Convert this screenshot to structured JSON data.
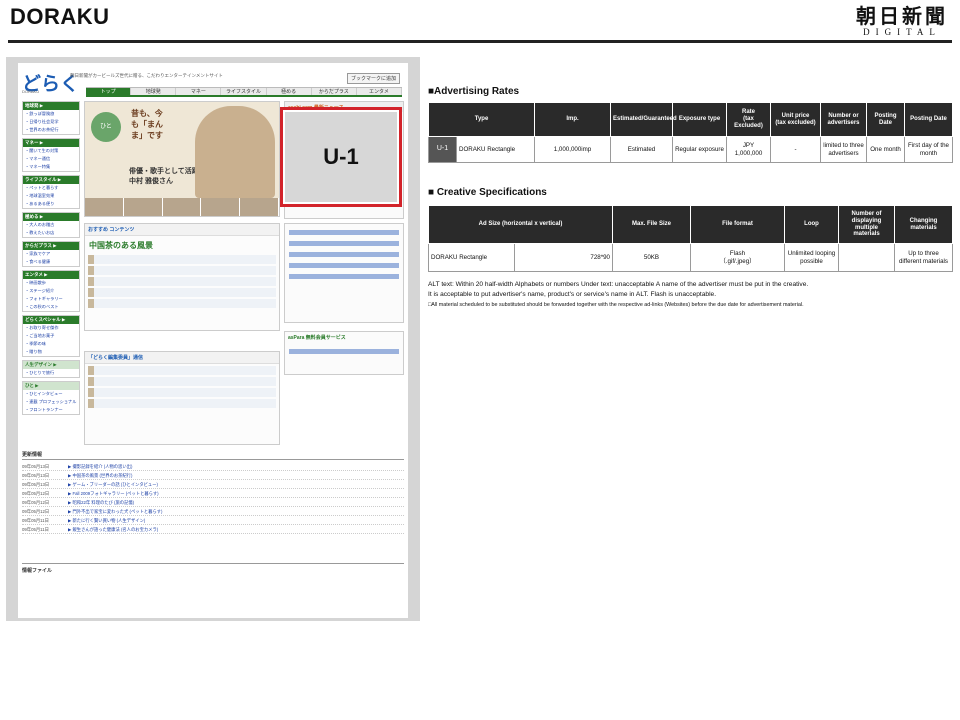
{
  "slide": {
    "title": "DORAKU",
    "logo_top": "朝日新聞",
    "logo_bottom": "DIGITAL"
  },
  "screenshot": {
    "brand": "どらく",
    "brand_sub": "DORAKU",
    "tagline": "朝日新聞がカービールズ世代に贈る、こだわりエンターテインメントサイト",
    "bookmark": "ブックマークに追加",
    "nav": [
      "トップ",
      "地球発",
      "マネー",
      "ライフスタイル",
      "極める",
      "からだプラス",
      "エンタメ"
    ],
    "left_nav": [
      {
        "head": "地球発 ▶",
        "items": [
          "・鉄っぽ冒険旅",
          "・日帰り社会見学",
          "・世界のお茶紀行"
        ]
      },
      {
        "head": "マネー ▶",
        "items": [
          "・聞いて生の対策",
          "・マネー通信",
          "・マネー特集"
        ]
      },
      {
        "head": "ライフスタイル ▶",
        "items": [
          "・ペットと暮らす",
          "・地球温室効果",
          "・あるある便り"
        ]
      },
      {
        "head": "極める ▶",
        "items": [
          "・大人のお稽古",
          "・教えたいお店"
        ]
      },
      {
        "head": "からだプラス ▶",
        "items": [
          "・家族でケア",
          "・食べる健康"
        ]
      },
      {
        "head": "エンタメ ▶",
        "items": [
          "・映画散歩",
          "・ステージ紹介",
          "・フォトギャラリー",
          "・この秋のベスト"
        ]
      },
      {
        "head": "どらくスペシャル ▶",
        "items": [
          "・お取り寄せ傑作",
          "・ご当地お菓子",
          "・季節の味",
          "・贈り物"
        ]
      },
      {
        "head": "人生デザイン ▶",
        "items": [
          "・ひとりで旅行"
        ]
      },
      {
        "head": "ひと ▶",
        "items": [
          "・ひとインタビュー",
          "・連載 プロフェッショナル",
          "・フロントランナー"
        ]
      }
    ],
    "hero_badge": "ひと",
    "hero_quote": "昔も、今も「まんま」です",
    "hero_caption": "俳優・歌手として活躍",
    "hero_name": "中村 雅俊さん",
    "ad_label": "U-1",
    "right_top_title": "asahi.com 最新ニュース",
    "recommend_title": "おすすめ コンテンツ",
    "recommend_sub": "中国茶のある風景",
    "editors_title": "「どらく編集委員」通信",
    "aspara_title": "asPara 無料会員サービス",
    "news_title": "更新情報",
    "news": [
      {
        "date": "09年05月13日",
        "text": "▶ 撮影記録を紹介 (人物の思い出)"
      },
      {
        "date": "09年05月13日",
        "text": "▶ 中国茶の風景 (世界のお茶紀行)"
      },
      {
        "date": "09年05月13日",
        "text": "▶ ゲーム・ブリーダーの話 (ひとインタビュー)"
      },
      {
        "date": "09年05月12日",
        "text": "▶ Fall 2009フォトギャラリー (ペットと暮らす)"
      },
      {
        "date": "09年05月12日",
        "text": "▶ 昭和22年 料理のたび (旅の記憶)"
      },
      {
        "date": "09年05月12日",
        "text": "▶ 門外不出で家宝に変わった犬 (ペットと暮らす)"
      },
      {
        "date": "09年05月11日",
        "text": "▶ 新たに行く賢い買い物 (人生デザイン)"
      },
      {
        "date": "09年05月11日",
        "text": "▶ 飯生さんが語った健康法 (名人のお宝カメラ)"
      }
    ],
    "info_title": "情報ファイル"
  },
  "rates": {
    "heading": "■Advertising Rates",
    "headers": [
      "Type",
      "Imp.",
      "Estimated/Guaranteed",
      "Exposure type",
      "Rate\n(tax Excluded)",
      "Unit price\n(tax excluded)",
      "Number or advertisers",
      "Posting Date",
      "Posting Date"
    ],
    "row": {
      "label": "U-1",
      "type": "DORAKU Rectangle",
      "imp": "1,000,000imp",
      "estimated": "Estimated",
      "exposure": "Regular exposure",
      "rate": "JPY 1,000,000",
      "unit_price": "-",
      "advertisers": "limited to three advertisers",
      "posting_period": "One month",
      "posting_date": "First day of the month"
    }
  },
  "specs": {
    "heading": "■ Creative Specifications",
    "headers": [
      "Ad Size (horizontal x vertical)",
      "",
      "Max. File Size",
      "File format",
      "Loop",
      "Number of displaying multiple materials",
      "Changing materials"
    ],
    "row": {
      "name": "DORAKU Rectangle",
      "size": "728*90",
      "max_size": "50KB",
      "format": "Flash\n（.gif/.jpeg）",
      "loop": "Unlimited looping possible",
      "multiple": "",
      "changing": "Up to three different materials"
    }
  },
  "notes": {
    "line1": "ALT text: Within 20 half-width Alphabets or numbers Under text: unacceptable A name of the advertiser must be put in the creative.",
    "line2": "It is acceptable to put advertiser's name, product's or service's name in ALT. Flash is unacceptable.",
    "line3": "□All material scheduled to be substituted should be forwarded together with the respective ad-links (Websites) before the due date for advertisement material."
  }
}
